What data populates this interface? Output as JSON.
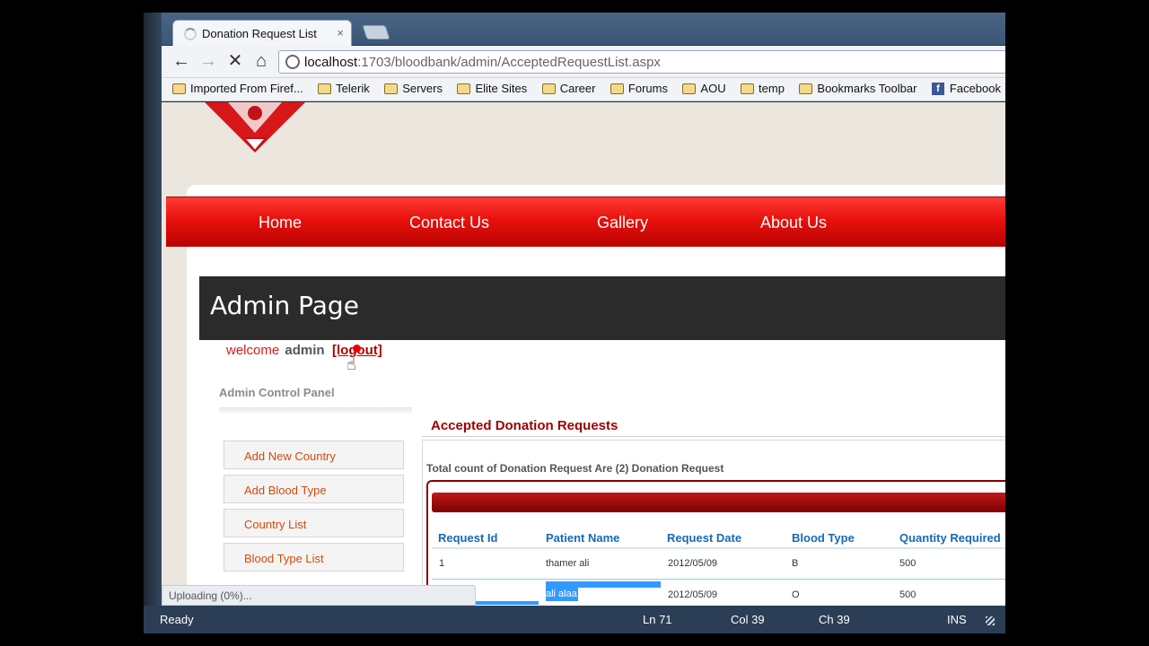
{
  "browser": {
    "tab_title": "Donation Request List",
    "tab_close": "×",
    "url_host": "localhost",
    "url_path": ":1703/bloodbank/admin/AcceptedRequestList.aspx",
    "back_icon": "back-arrow-icon",
    "forward_icon": "forward-arrow-icon",
    "stop_icon": "stop-icon",
    "home_icon": "home-icon"
  },
  "bookmarks": [
    {
      "label": "Imported From Firef...",
      "icon": "folder"
    },
    {
      "label": "Telerik",
      "icon": "folder"
    },
    {
      "label": "Servers",
      "icon": "folder"
    },
    {
      "label": "Elite Sites",
      "icon": "folder"
    },
    {
      "label": "Career",
      "icon": "folder"
    },
    {
      "label": "Forums",
      "icon": "folder"
    },
    {
      "label": "AOU",
      "icon": "folder"
    },
    {
      "label": "temp",
      "icon": "folder"
    },
    {
      "label": "Bookmarks Toolbar",
      "icon": "folder"
    },
    {
      "label": "Facebook",
      "icon": "facebook"
    }
  ],
  "menu": {
    "home": "Home",
    "contact": "Contact Us",
    "gallery": "Gallery",
    "about": "About Us",
    "color": "#e8110c"
  },
  "admin": {
    "title": "Admin Page",
    "welcome": "welcome",
    "user": "admin",
    "logout": "[logout]",
    "panel_title": "Admin Control Panel",
    "side_buttons": [
      "Add New Country",
      "Add Blood Type",
      "Country List",
      "Blood Type List"
    ]
  },
  "requests": {
    "title": "Accepted Donation Requests",
    "total": "Total count of Donation Request Are (2) Donation Request",
    "columns": [
      "Request Id",
      "Patient Name",
      "Request Date",
      "Blood Type",
      "Quantity Required"
    ],
    "rows": [
      {
        "id": "1",
        "name": "thamer ali",
        "date": "2012/05/09",
        "blood": "B",
        "qty": "500"
      },
      {
        "name": "ali alaa",
        "date": "2012/05/09",
        "blood": "O",
        "qty": "500"
      }
    ]
  },
  "browser_status": "Uploading (0%)...",
  "ide_status": {
    "ready": "Ready",
    "ln": "Ln 71",
    "col": "Col 39",
    "ch": "Ch 39",
    "mode": "INS"
  }
}
